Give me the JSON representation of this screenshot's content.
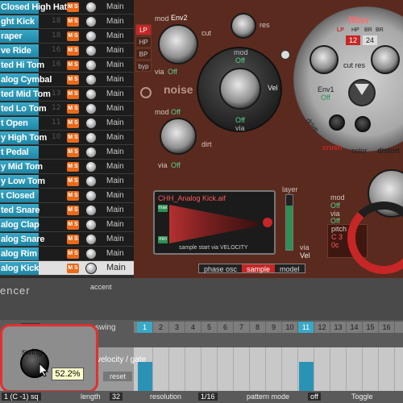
{
  "instruments": [
    {
      "name": "Closed High Hat",
      "num": "",
      "out": "Main"
    },
    {
      "name": "ght Kick",
      "num": "18",
      "out": "Main"
    },
    {
      "name": "raper",
      "num": "18",
      "out": "Main"
    },
    {
      "name": "ve Ride",
      "num": "16",
      "out": "Main"
    },
    {
      "name": "ted Hi Tom",
      "num": "16",
      "out": "Main"
    },
    {
      "name": "alog Cymbal",
      "num": "",
      "out": "Main"
    },
    {
      "name": "ted Mid Tom",
      "num": "13",
      "out": "Main"
    },
    {
      "name": "ted Lo Tom",
      "num": "12",
      "out": "Main"
    },
    {
      "name": "t Open",
      "num": "11",
      "out": "Main"
    },
    {
      "name": "y High Tom",
      "num": "10",
      "out": "Main"
    },
    {
      "name": "t Pedal",
      "num": "",
      "out": "Main"
    },
    {
      "name": "y Mid Tom",
      "num": "",
      "out": "Main"
    },
    {
      "name": "y Low Tom",
      "num": "",
      "out": "Main"
    },
    {
      "name": "t Closed",
      "num": "",
      "out": "Main"
    },
    {
      "name": "ted Snare",
      "num": "",
      "out": "Main"
    },
    {
      "name": "alog Clap",
      "num": "",
      "out": "Main"
    },
    {
      "name": "alog Snare",
      "num": "",
      "out": "Main"
    },
    {
      "name": "alog Rim",
      "num": "",
      "out": "Main"
    },
    {
      "name": "alog Kick",
      "num": "",
      "out": "Main",
      "selected": true
    }
  ],
  "ms_label": "M S",
  "synth": {
    "filter_modes": [
      "LP",
      "HP",
      "BP",
      "byp"
    ],
    "filter_title": "filter",
    "filter_types": [
      "LP",
      "HP",
      "BR",
      "BR"
    ],
    "slope_12": "12",
    "slope_24": "24",
    "cut_label": "cut",
    "res_label": "res",
    "mod_label": "mod",
    "env2": "Env2",
    "env1": "Env1",
    "via_label": "via",
    "off": "Off",
    "noise_label": "noise",
    "dirt_label": "dirt",
    "vel_label": "Vel",
    "drive_label": "drive",
    "color_label": "color",
    "crush_label": "crush",
    "distort_label": "distort",
    "sample_file": "CHH_Analog Kick.aif",
    "sample_max": "max",
    "sample_min": "min",
    "sample_caption": "sample start via VELOCITY",
    "layer_label": "layer",
    "tabs": [
      "phase osc",
      "sample",
      "model"
    ],
    "active_tab": "sample",
    "pitch_label": "pitch",
    "pitch_value": "C 3",
    "pitch_cents": "0c"
  },
  "sequencer": {
    "title": "encer",
    "accent_label": "accent",
    "swing_label": "swing",
    "steps": [
      "1",
      "2",
      "3",
      "4",
      "5",
      "6",
      "7",
      "8",
      "9",
      "10",
      "11",
      "12",
      "13",
      "14",
      "15",
      "16"
    ],
    "highlighted_steps": [
      1,
      11
    ],
    "velocity_gate_label": "velocity / gate",
    "reset_label": "reset",
    "swing_knob_label": "swing",
    "swing_tooltip": "52.2%",
    "swing_value_percent": 52.2,
    "bars": [
      0.7,
      0,
      0,
      0,
      0,
      0,
      0,
      0,
      0,
      0,
      0.7,
      0,
      0,
      0,
      0,
      0
    ]
  },
  "bottom": {
    "pattern_select": "1 (C -1) sq",
    "length_label": "length",
    "length_value": "32",
    "resolution_label": "resolution",
    "resolution_value": "1/16",
    "pattern_mode_label": "pattern mode",
    "pattern_mode_value": "off",
    "toggle_label": "Toggle"
  },
  "colors": {
    "accent_red": "#c62626",
    "list_blue": "#3aa8c6",
    "ms_orange": "#e86a1a"
  }
}
